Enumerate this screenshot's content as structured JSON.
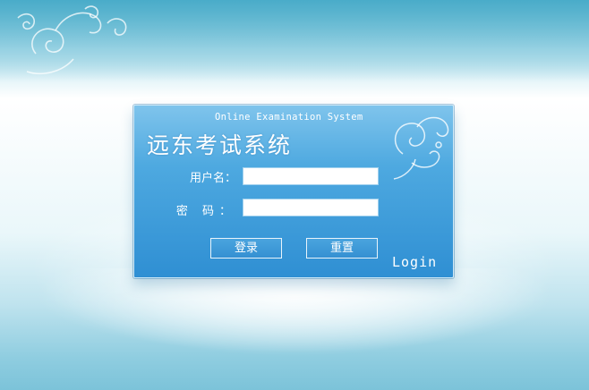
{
  "header": {
    "decoration_icon": "swirl-ornament-icon"
  },
  "login_panel": {
    "subtitle": "Online Examination System",
    "title": "远东考试系统",
    "username_label": "用户名：",
    "password_label": "密  码：",
    "username_value": "",
    "password_value": "",
    "login_button_label": "登录",
    "reset_button_label": "重置",
    "footer_word": "Login",
    "decoration_icon": "swirl-ornament-icon"
  },
  "colors": {
    "panel_top": "#7fc4ec",
    "panel_bottom": "#2f8fd3",
    "page_top": "#5fb6cf",
    "page_bottom": "#7cc3d9",
    "text": "#ffffff"
  }
}
